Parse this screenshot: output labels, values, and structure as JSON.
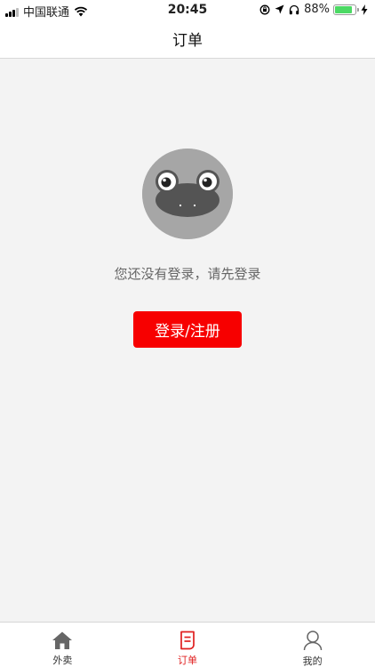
{
  "status_bar": {
    "carrier": "中国联通",
    "time": "20:45",
    "battery_percent": "88%",
    "battery_level": 0.88,
    "battery_color": "#4cd964"
  },
  "nav": {
    "title": "订单"
  },
  "main": {
    "prompt": "您还没有登录，请先登录",
    "login_button": "登录/注册",
    "button_color": "#f70000"
  },
  "tab_bar": {
    "active_color": "#e02020",
    "tabs": [
      {
        "label": "外卖",
        "icon": "home-icon",
        "active": false
      },
      {
        "label": "订单",
        "icon": "order-icon",
        "active": true
      },
      {
        "label": "我的",
        "icon": "user-icon",
        "active": false
      }
    ]
  }
}
